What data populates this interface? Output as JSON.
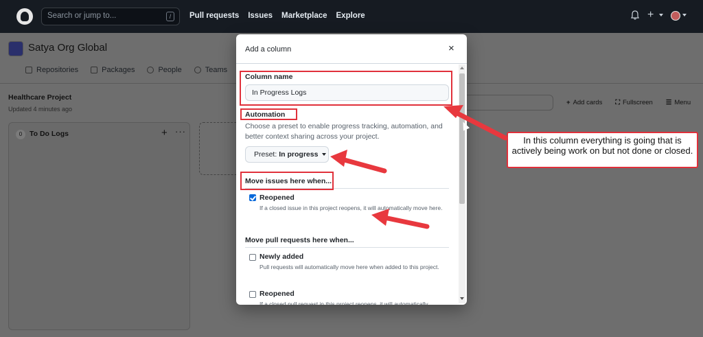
{
  "topbar": {
    "search_placeholder": "Search or jump to...",
    "search_key": "/",
    "nav": [
      "Pull requests",
      "Issues",
      "Marketplace",
      "Explore"
    ],
    "plus_label": "+"
  },
  "org": {
    "name": "Satya Org Global",
    "tabs": [
      "Repositories",
      "Packages",
      "People",
      "Teams"
    ]
  },
  "project": {
    "title": "Healthcare Project",
    "updated": "Updated 4 minutes ago",
    "tools": {
      "add_cards": "Add cards",
      "fullscreen": "Fullscreen",
      "menu": "Menu"
    },
    "column": {
      "count": "0",
      "name": "To Do Logs",
      "add": "+",
      "more": "···"
    }
  },
  "modal": {
    "title": "Add a column",
    "close": "×",
    "column_name_label": "Column name",
    "column_name_value": "In Progress Logs",
    "automation_label": "Automation",
    "automation_desc": "Choose a preset to enable progress tracking, automation, and better context sharing across your project.",
    "preset_prefix": "Preset:",
    "preset_value": "In progress",
    "issues_heading": "Move issues here when...",
    "issues_options": [
      {
        "label": "Reopened",
        "desc": "If a closed issue in this project reopens, it will automatically move here.",
        "checked": true
      }
    ],
    "prs_heading": "Move pull requests here when...",
    "prs_options": [
      {
        "label": "Newly added",
        "desc": "Pull requests will automatically move here when added to this project.",
        "checked": false
      },
      {
        "label": "Reopened",
        "desc": "If a closed pull request in this project reopens, it will automatically",
        "checked": false
      }
    ]
  },
  "annotation": {
    "callout": "In this column everything is going that is actively being work on but not done or closed.",
    "color": "#e0303a"
  }
}
